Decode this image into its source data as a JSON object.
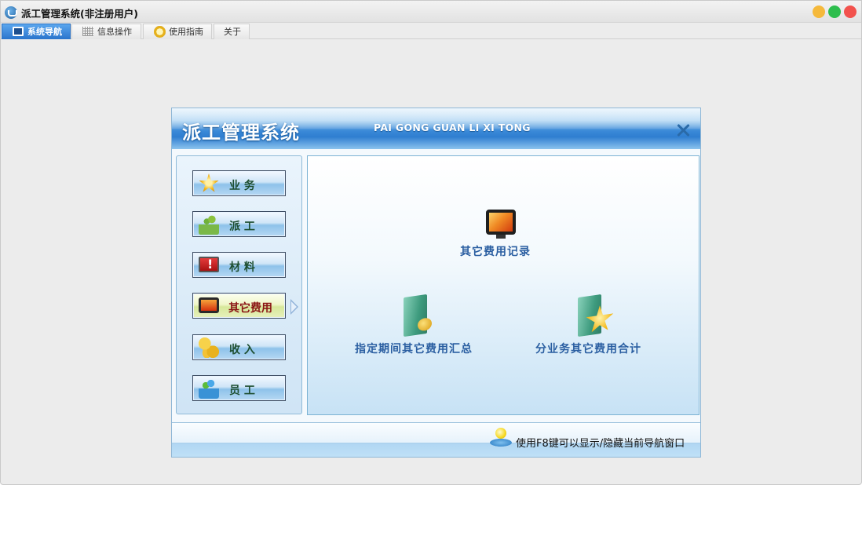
{
  "window": {
    "title": "派工管理系统(非注册用户)"
  },
  "tabs": [
    {
      "label": "系统导航",
      "icon": "monitor-icon",
      "active": true
    },
    {
      "label": "信息操作",
      "icon": "grid-icon",
      "active": false
    },
    {
      "label": "使用指南",
      "icon": "guide-icon",
      "active": false
    },
    {
      "label": "关于",
      "icon": "",
      "active": false
    }
  ],
  "dialog": {
    "title": "派工管理系统",
    "subtitle": "PAI GONG GUAN LI XI TONG"
  },
  "categories": [
    {
      "label": "业  务",
      "icon": "star-icon"
    },
    {
      "label": "派  工",
      "icon": "workers-icon"
    },
    {
      "label": "材  料",
      "icon": "alert-monitor-icon"
    },
    {
      "label": "其它费用",
      "icon": "monitor-icon",
      "active": true
    },
    {
      "label": "收  入",
      "icon": "coins-icon"
    },
    {
      "label": "员  工",
      "icon": "people-icon"
    }
  ],
  "functions": [
    {
      "label": "其它费用记录",
      "icon": "monitor-icon"
    },
    {
      "label": "指定期间其它费用汇总",
      "icon": "folder-coins-icon"
    },
    {
      "label": "分业务其它费用合计",
      "icon": "folder-star-icon"
    }
  ],
  "footer": {
    "hint": "使用F8键可以显示/隐藏当前导航窗口"
  },
  "colors": {
    "accent": "#2a74cc",
    "active_category": "#8a1414",
    "function_text": "#2a5ea1"
  }
}
